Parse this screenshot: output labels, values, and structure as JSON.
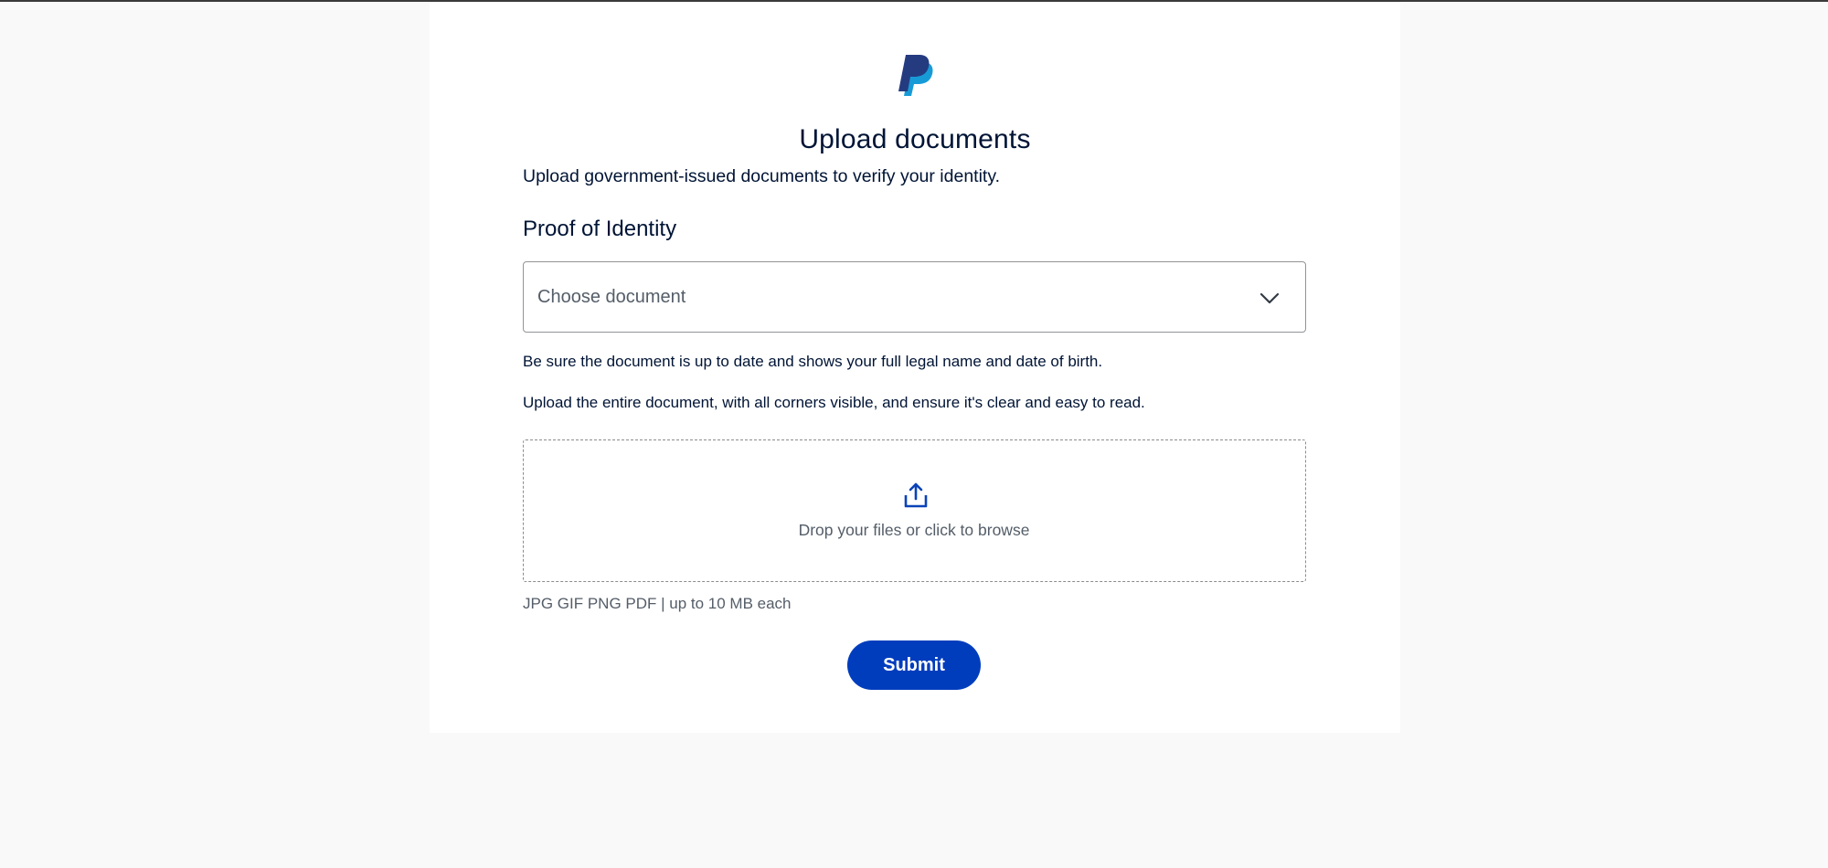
{
  "header": {
    "logo_icon": "paypal-logo-icon",
    "title": "Upload documents",
    "subtitle": "Upload government-issued documents to verify your identity."
  },
  "proof_of_identity": {
    "section_title": "Proof of Identity",
    "select_placeholder": "Choose document",
    "select_icon": "chevron-down-icon",
    "note_1": "Be sure the document is up to date and shows your full legal name and date of birth.",
    "note_2": "Upload the entire document, with all corners visible, and ensure it's clear and easy to read."
  },
  "upload": {
    "icon": "upload-icon",
    "dropzone_text": "Drop your files or click to browse",
    "file_info": "JPG GIF PNG PDF | up to 10 MB each"
  },
  "actions": {
    "submit_label": "Submit"
  },
  "colors": {
    "primary": "#003dbd",
    "text": "#001435",
    "muted_text": "#545d68",
    "page_background": "#f9f9f9",
    "card_background": "#ffffff",
    "logo_dark": "#253b80",
    "logo_light": "#179bd7"
  }
}
